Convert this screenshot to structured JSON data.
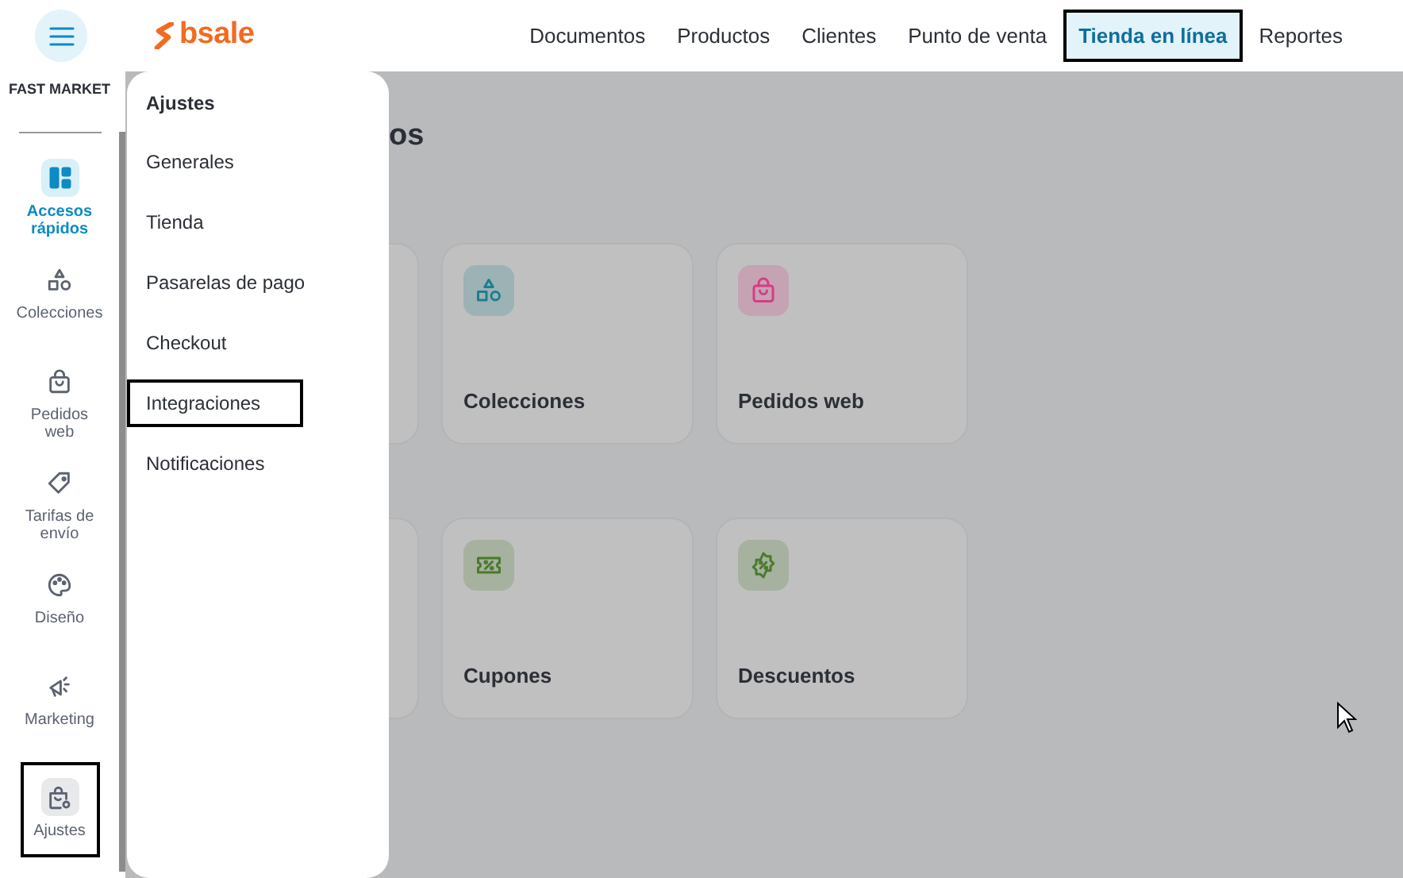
{
  "header": {
    "logo": "bsale",
    "nav": [
      {
        "label": "Documentos",
        "selected": false,
        "outlined": false
      },
      {
        "label": "Productos",
        "selected": false,
        "outlined": false
      },
      {
        "label": "Clientes",
        "selected": false,
        "outlined": false
      },
      {
        "label": "Punto de venta",
        "selected": false,
        "outlined": false
      },
      {
        "label": "Tienda en línea",
        "selected": true,
        "outlined": true
      },
      {
        "label": "Reportes",
        "selected": false,
        "outlined": false
      }
    ]
  },
  "sidebar": {
    "store_name": "FAST MARKET",
    "items": [
      {
        "label": "Accesos rápidos",
        "kind": "grid",
        "selected": true,
        "outlined": false
      },
      {
        "label": "Colecciones",
        "kind": "shapes",
        "selected": false,
        "outlined": false
      },
      {
        "label": "Pedidos web",
        "kind": "bag",
        "selected": false,
        "outlined": false
      },
      {
        "label": "Tarifas de envío",
        "kind": "tag",
        "selected": false,
        "outlined": false
      },
      {
        "label": "Diseño",
        "kind": "palette",
        "selected": false,
        "outlined": false
      },
      {
        "label": "Marketing",
        "kind": "megaphone",
        "selected": false,
        "outlined": false
      },
      {
        "label": "Ajustes",
        "kind": "settings-bag",
        "selected": false,
        "outlined": true
      }
    ]
  },
  "flyout": {
    "title": "Ajustes",
    "items": [
      {
        "label": "Generales",
        "outlined": false
      },
      {
        "label": "Tienda",
        "outlined": false
      },
      {
        "label": "Pasarelas de pago",
        "outlined": false
      },
      {
        "label": "Checkout",
        "outlined": false
      },
      {
        "label": "Integraciones",
        "outlined": true
      },
      {
        "label": "Notificaciones",
        "outlined": false
      }
    ]
  },
  "main": {
    "heading": "os",
    "card_rows": [
      [
        {
          "kind": "hidden"
        },
        {
          "kind": "shapes",
          "title": "Colecciones",
          "color": "#1d7f8c"
        },
        {
          "kind": "bag",
          "title": "Pedidos web",
          "color": "#d63c86"
        }
      ],
      [
        {
          "kind": "hidden"
        },
        {
          "kind": "coupon",
          "title": "Cupones",
          "color": "#4a7a2a"
        },
        {
          "kind": "badge",
          "title": "Descuentos",
          "color": "#4a7a2a"
        }
      ]
    ]
  }
}
